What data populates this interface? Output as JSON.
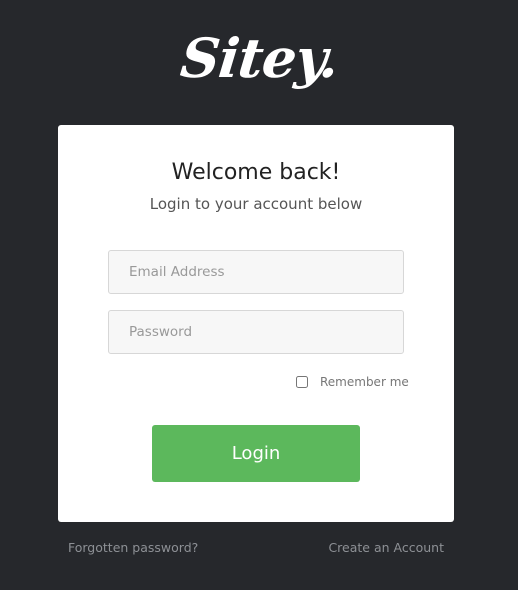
{
  "brand": {
    "logo_text": "Sitey."
  },
  "login_card": {
    "title": "Welcome back!",
    "subtitle": "Login to your account below",
    "email_placeholder": "Email Address",
    "password_placeholder": "Password",
    "remember_label": "Remember me",
    "remember_checked": false,
    "login_button_label": "Login"
  },
  "footer": {
    "forgot_password_label": "Forgotten password?",
    "create_account_label": "Create an Account"
  },
  "colors": {
    "page_background": "#26282c",
    "card_background": "#ffffff",
    "login_button": "#5cb85c",
    "footer_link": "#8d9095"
  }
}
